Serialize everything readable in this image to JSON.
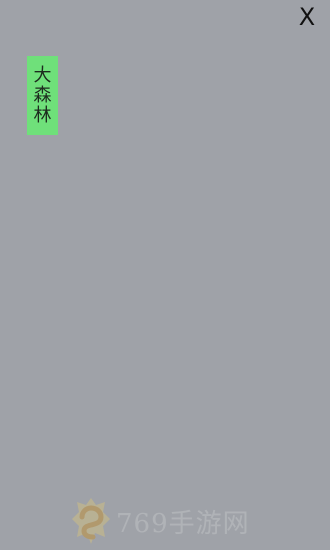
{
  "app": {
    "close_label": "X"
  },
  "location": {
    "label": "大森林"
  },
  "watermark": {
    "text": "769手游网"
  },
  "colors": {
    "background": "#9fa2a8",
    "tag_background": "#6fe07a",
    "close_icon": "#111111"
  }
}
